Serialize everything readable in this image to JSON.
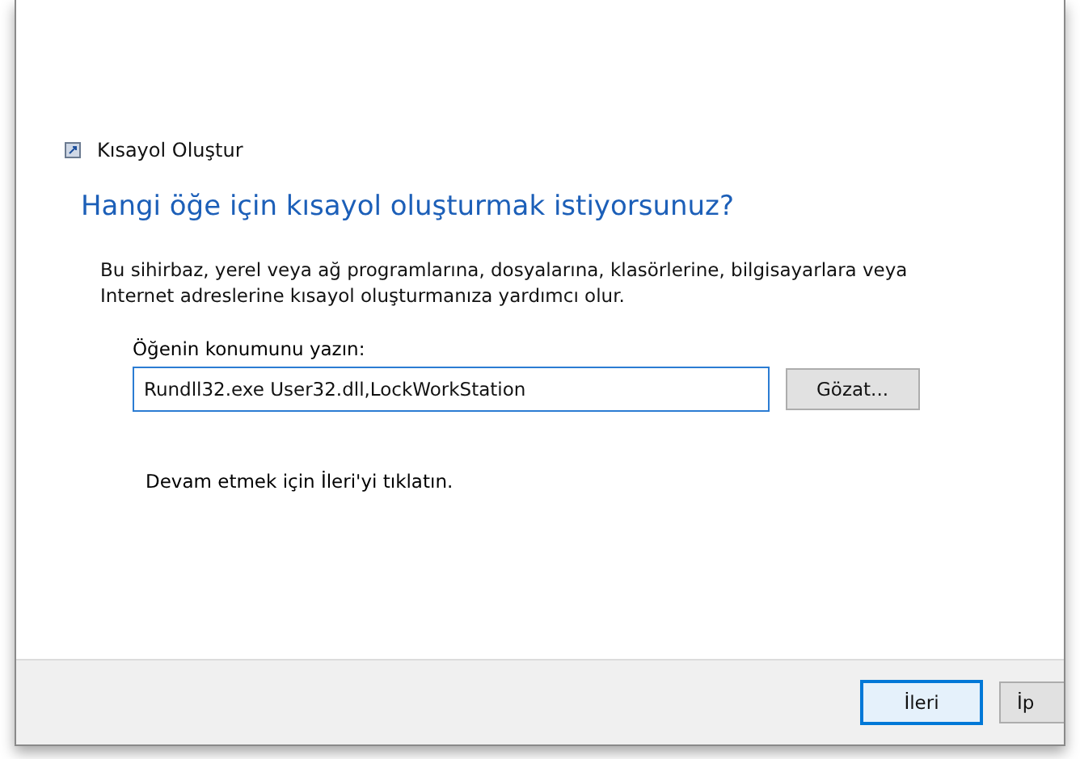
{
  "window": {
    "title": "Kısayol Oluştur"
  },
  "heading": "Hangi öğe için kısayol oluşturmak istiyorsunuz?",
  "description": "Bu sihirbaz, yerel veya ağ programlarına, dosyalarına, klasörlerine, bilgisayarlara veya Internet adreslerine kısayol oluşturmanıza yardımcı olur.",
  "location": {
    "label": "Öğenin konumunu yazın:",
    "value": "Rundll32.exe User32.dll,LockWorkStation"
  },
  "browse_button": "Gözat...",
  "hint": "Devam etmek için İleri'yi tıklatın.",
  "buttons": [
    {
      "label": "İleri",
      "focused": true
    },
    {
      "label": "İp",
      "focused": false
    }
  ]
}
